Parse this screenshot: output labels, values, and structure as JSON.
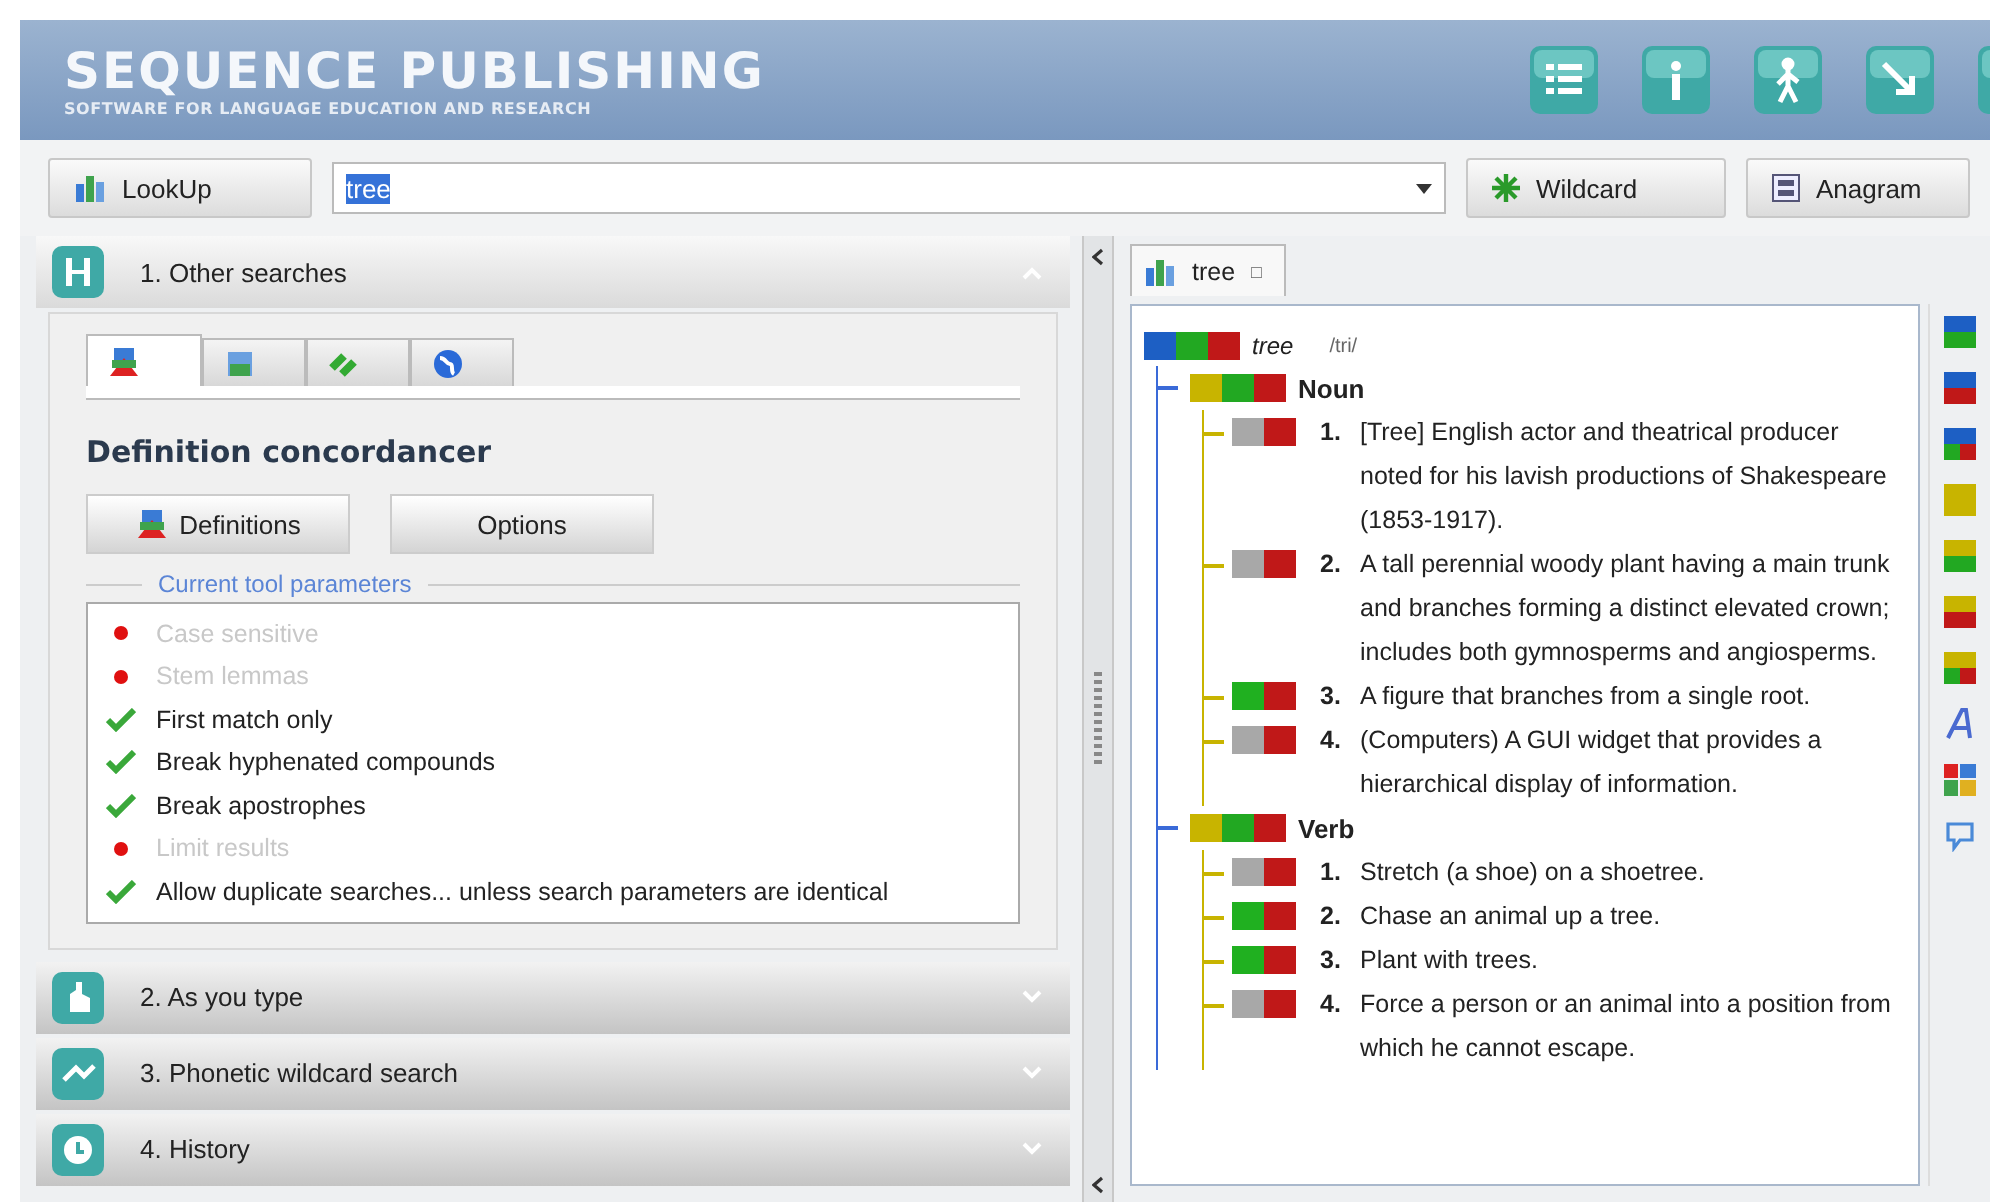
{
  "brand": {
    "title": "SEQUENCE PUBLISHING",
    "subtitle": "SOFTWARE FOR LANGUAGE EDUCATION AND RESEARCH"
  },
  "search": {
    "lookup_button": "LookUp",
    "value": "tree",
    "wildcard_button": "Wildcard",
    "anagram_button": "Anagram"
  },
  "sections": [
    {
      "label": "1. Other searches",
      "expanded": true
    },
    {
      "label": "2. As you type",
      "expanded": false
    },
    {
      "label": "3. Phonetic wildcard search",
      "expanded": false
    },
    {
      "label": "4. History",
      "expanded": false
    }
  ],
  "tool_tabs": [
    {
      "kind": "definitions",
      "selected": true
    },
    {
      "kind": "document",
      "selected": false
    },
    {
      "kind": "links",
      "selected": false
    },
    {
      "kind": "globe",
      "selected": false
    }
  ],
  "tool": {
    "title": "Definition concordancer",
    "definitions_button": "Definitions",
    "options_button": "Options",
    "legend": "Current tool parameters"
  },
  "parameters": [
    {
      "label": "Case sensitive",
      "on": false
    },
    {
      "label": "Stem lemmas",
      "on": false
    },
    {
      "label": "First match only",
      "on": true
    },
    {
      "label": "Break hyphenated compounds",
      "on": true
    },
    {
      "label": "Break apostrophes",
      "on": true
    },
    {
      "label": "Limit results",
      "on": false
    },
    {
      "label": "Allow duplicate searches... unless search parameters are identical",
      "on": true
    }
  ],
  "result_tab": {
    "label": "tree",
    "close": "□"
  },
  "entry": {
    "word": "tree",
    "pronunciation": "/tri/",
    "groups": [
      {
        "label": "Noun",
        "senses": [
          {
            "number": "1.",
            "text": "[Tree] English actor and theatrical producer noted for his lavish productions of Shakespeare (1853-1917).",
            "color": "#a8a8a8"
          },
          {
            "number": "2.",
            "text": "A tall perennial woody plant having a main trunk and branches forming a distinct elevated crown; includes both gymnosperms and angiosperms.",
            "color": "#a8a8a8"
          },
          {
            "number": "3.",
            "text": "A figure that branches from a single root.",
            "color": "#20b020"
          },
          {
            "number": "4.",
            "text": "(Computers) A GUI widget that provides a hierarchical display of information.",
            "color": "#a8a8a8"
          }
        ]
      },
      {
        "label": "Verb",
        "senses": [
          {
            "number": "1.",
            "text": "Stretch (a shoe) on a shoetree.",
            "color": "#a8a8a8"
          },
          {
            "number": "2.",
            "text": "Chase an animal up a tree.",
            "color": "#20b020"
          },
          {
            "number": "3.",
            "text": "Plant with trees.",
            "color": "#20b020"
          },
          {
            "number": "4.",
            "text": "Force a person or an animal into a position from which he cannot escape.",
            "color": "#a8a8a8"
          }
        ]
      }
    ]
  }
}
